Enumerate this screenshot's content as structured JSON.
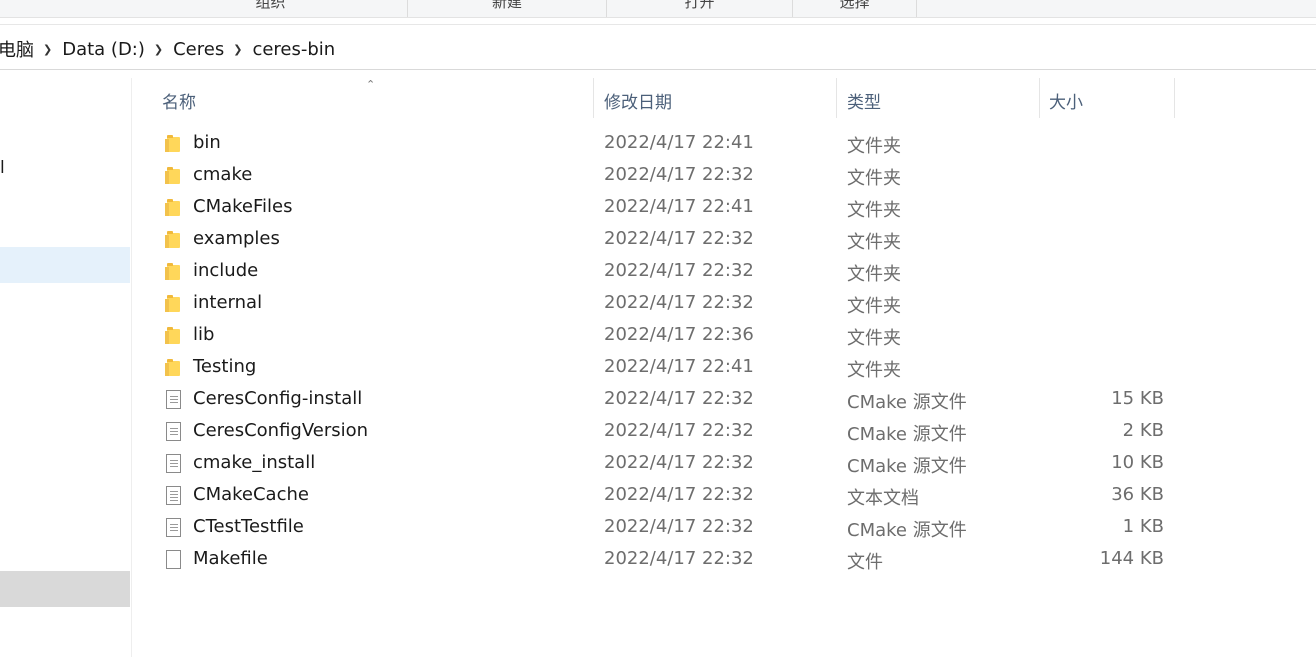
{
  "ribbon": {
    "groups": [
      "组织",
      "新建",
      "打开",
      "选择"
    ]
  },
  "breadcrumb": {
    "items": [
      "电脑",
      "Data (D:)",
      "Ceres",
      "ceres-bin"
    ]
  },
  "nav": {
    "stub_text": "l"
  },
  "columns": {
    "name": "名称",
    "modified": "修改日期",
    "type": "类型",
    "size": "大小"
  },
  "files": [
    {
      "icon": "folder-icon",
      "name": "bin",
      "modified": "2022/4/17 22:41",
      "type": "文件夹",
      "size": ""
    },
    {
      "icon": "folder-icon",
      "name": "cmake",
      "modified": "2022/4/17 22:32",
      "type": "文件夹",
      "size": ""
    },
    {
      "icon": "folder-icon",
      "name": "CMakeFiles",
      "modified": "2022/4/17 22:41",
      "type": "文件夹",
      "size": ""
    },
    {
      "icon": "folder-icon",
      "name": "examples",
      "modified": "2022/4/17 22:32",
      "type": "文件夹",
      "size": ""
    },
    {
      "icon": "folder-icon",
      "name": "include",
      "modified": "2022/4/17 22:32",
      "type": "文件夹",
      "size": ""
    },
    {
      "icon": "folder-icon",
      "name": "internal",
      "modified": "2022/4/17 22:32",
      "type": "文件夹",
      "size": ""
    },
    {
      "icon": "folder-icon",
      "name": "lib",
      "modified": "2022/4/17 22:36",
      "type": "文件夹",
      "size": ""
    },
    {
      "icon": "folder-icon",
      "name": "Testing",
      "modified": "2022/4/17 22:41",
      "type": "文件夹",
      "size": ""
    },
    {
      "icon": "text-file-icon",
      "name": "CeresConfig-install",
      "modified": "2022/4/17 22:32",
      "type": "CMake 源文件",
      "size": "15 KB"
    },
    {
      "icon": "text-file-icon",
      "name": "CeresConfigVersion",
      "modified": "2022/4/17 22:32",
      "type": "CMake 源文件",
      "size": "2 KB"
    },
    {
      "icon": "text-file-icon",
      "name": "cmake_install",
      "modified": "2022/4/17 22:32",
      "type": "CMake 源文件",
      "size": "10 KB"
    },
    {
      "icon": "text-document-icon",
      "name": "CMakeCache",
      "modified": "2022/4/17 22:32",
      "type": "文本文档",
      "size": "36 KB"
    },
    {
      "icon": "text-file-icon",
      "name": "CTestTestfile",
      "modified": "2022/4/17 22:32",
      "type": "CMake 源文件",
      "size": "1 KB"
    },
    {
      "icon": "blank-file-icon",
      "name": "Makefile",
      "modified": "2022/4/17 22:32",
      "type": "文件",
      "size": "144 KB"
    }
  ]
}
